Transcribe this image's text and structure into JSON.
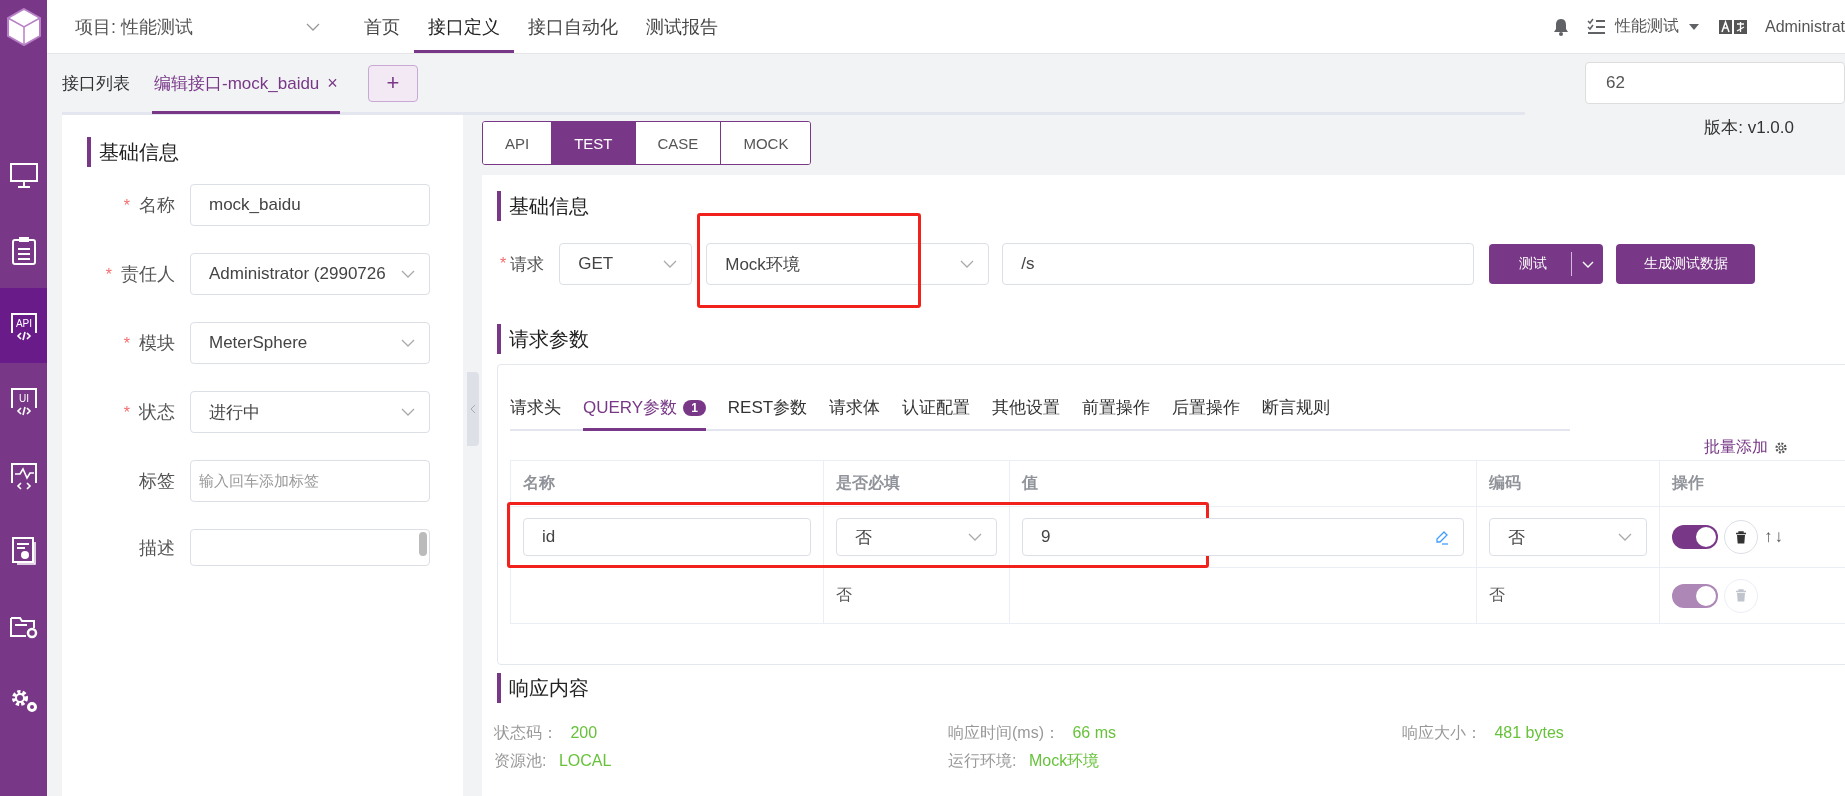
{
  "sidebar": {
    "items": [
      {
        "selected": false
      },
      {
        "selected": false
      },
      {
        "label": "API",
        "selected": true
      },
      {
        "label": "UI",
        "selected": false
      },
      {
        "selected": false
      },
      {
        "selected": false
      },
      {
        "selected": false
      },
      {
        "selected": false
      }
    ]
  },
  "header": {
    "project": "项目: 性能测试",
    "nav": [
      {
        "label": "首页",
        "selected": false
      },
      {
        "label": "接口定义",
        "selected": true
      },
      {
        "label": "接口自动化",
        "selected": false
      },
      {
        "label": "测试报告",
        "selected": false
      }
    ],
    "workspace": "性能测试",
    "user": "Administrat"
  },
  "page_tabs": [
    {
      "label": "接口列表",
      "selected": false
    },
    {
      "label": "编辑接口-mock_baidu",
      "selected": true,
      "close": "×"
    }
  ],
  "add_tab": "+",
  "project_id": "62",
  "version": "版本: v1.0.0",
  "required_mark": "*",
  "basic_info": {
    "title": "基础信息",
    "fields": [
      {
        "label": "名称",
        "required": true,
        "kind": "input",
        "value": "mock_baidu"
      },
      {
        "label": "责任人",
        "required": true,
        "kind": "select",
        "value": "Administrator (2990726"
      },
      {
        "label": "模块",
        "required": true,
        "kind": "select",
        "value": "MeterSphere"
      },
      {
        "label": "状态",
        "required": true,
        "kind": "select",
        "value": "进行中"
      },
      {
        "label": "标签",
        "required": false,
        "kind": "input",
        "placeholder": "输入回车添加标签"
      },
      {
        "label": "描述",
        "required": false,
        "kind": "textarea"
      }
    ]
  },
  "mode_tabs": [
    {
      "label": "API",
      "selected": false
    },
    {
      "label": "TEST",
      "selected": true
    },
    {
      "label": "CASE",
      "selected": false
    },
    {
      "label": "MOCK",
      "selected": false
    }
  ],
  "request": {
    "title": "基础信息",
    "label": "请求",
    "method": "GET",
    "environment": "Mock环境",
    "environment_highlighted": true,
    "path": "/s",
    "test_button": "测试",
    "generate_button": "生成测试数据"
  },
  "params": {
    "title": "请求参数",
    "tabs": [
      {
        "label": "请求头",
        "selected": false
      },
      {
        "label": "QUERY参数",
        "selected": true,
        "badge": "1"
      },
      {
        "label": "REST参数",
        "selected": false
      },
      {
        "label": "请求体",
        "selected": false
      },
      {
        "label": "认证配置",
        "selected": false
      },
      {
        "label": "其他设置",
        "selected": false
      },
      {
        "label": "前置操作",
        "selected": false
      },
      {
        "label": "后置操作",
        "selected": false
      },
      {
        "label": "断言规则",
        "selected": false
      }
    ],
    "batch_add": "批量添加",
    "columns": [
      "名称",
      "是否必填",
      "值",
      "编码",
      "操作"
    ],
    "rows": [
      {
        "kind": "input",
        "name": "id",
        "required": "否",
        "value": "9",
        "encoding": "否",
        "enabled": true,
        "disabled": false,
        "highlighted": true,
        "arrows": "↑↓"
      },
      {
        "kind": "plain",
        "required": "否",
        "encoding": "否",
        "enabled": true,
        "disabled": true,
        "highlighted": false
      }
    ]
  },
  "response": {
    "title": "响应内容",
    "items": [
      {
        "label": "状态码：",
        "value": "200"
      },
      {
        "label": "响应时间(ms)：",
        "value": "66 ms"
      },
      {
        "label": "响应大小：",
        "value": "481 bytes"
      },
      {
        "label": "资源池:",
        "value": "LOCAL"
      },
      {
        "label": "运行环境:",
        "value": "Mock环境"
      }
    ]
  }
}
